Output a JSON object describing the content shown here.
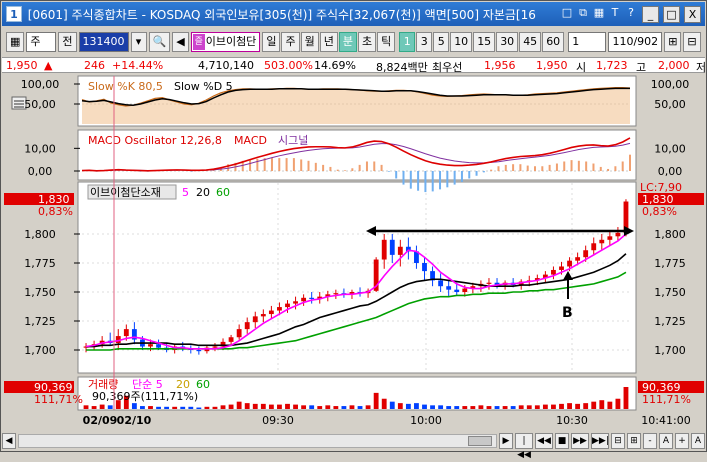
{
  "window": {
    "number_badge": "1",
    "title": "[0601] 주식종합차트 - KOSDAQ 외국인보유[305(천)] 주식수[32,067(천)] 액면[500] 자본금[16",
    "title_icons": [
      "□",
      "⧉",
      "▦",
      "T",
      "?"
    ],
    "controls": [
      "_",
      "□",
      "X"
    ]
  },
  "toolbar": {
    "list_icon": "▦",
    "market_select": "주",
    "all_label": "전",
    "stock_code": "131400",
    "search_icon": "🔍",
    "sound_icon": "◀",
    "event_stock": "이브이첨단",
    "period_buttons": [
      "일",
      "주",
      "월",
      "년",
      "분",
      "초",
      "틱"
    ],
    "active_period": "분",
    "interval_buttons": [
      "1",
      "3",
      "5",
      "10",
      "15",
      "30",
      "45",
      "60"
    ],
    "active_interval": "1",
    "interval_select": "1",
    "count_value": "110/902",
    "extra_icons": [
      "⊞",
      "⊟"
    ]
  },
  "pricebar": {
    "price": "1,950",
    "up_arrow": "▲",
    "change": "246",
    "rate": "+14.44%",
    "volume": "4,710,140",
    "vol_ratio": "503.00%",
    "turnover": "14.69%",
    "amount": "8,824백만",
    "prev_label": "최우선",
    "bid1": "1,956",
    "bid2": "1,950",
    "open_label": "시",
    "open": "1,723",
    "high_label": "고",
    "high": "2,000",
    "low_label": "저"
  },
  "stoch": {
    "legend_k": "Slow %K 80,5",
    "legend_d": "Slow %D 5",
    "y_ticks": [
      "100,00",
      "50,00"
    ],
    "k_series": [
      61,
      55,
      58,
      62,
      52,
      48,
      45,
      47,
      52,
      58,
      64,
      66,
      60,
      55,
      50,
      48,
      52,
      60,
      70,
      78,
      83,
      86,
      88,
      88,
      87,
      87,
      88,
      88,
      89,
      89,
      88,
      87,
      87,
      88,
      88,
      88,
      87,
      86,
      85,
      83,
      82,
      82,
      83,
      84,
      84,
      83,
      80,
      76,
      72,
      70,
      69,
      70,
      71,
      73,
      74,
      75,
      74,
      73,
      73,
      72,
      72,
      73,
      75,
      76,
      77,
      78,
      80,
      82,
      84,
      86,
      88,
      89,
      90,
      91,
      91,
      90
    ],
    "d_series": [
      58,
      56,
      57,
      59,
      55,
      51,
      48,
      47,
      50,
      55,
      60,
      63,
      61,
      57,
      53,
      50,
      51,
      56,
      65,
      73,
      80,
      84,
      86,
      87,
      87,
      87,
      87,
      88,
      88,
      88,
      88,
      87,
      87,
      87,
      87,
      87,
      87,
      86,
      85,
      84,
      83,
      82,
      82,
      83,
      83,
      83,
      81,
      78,
      75,
      72,
      70,
      70,
      70,
      71,
      72,
      73,
      73,
      73,
      73,
      72,
      72,
      72,
      73,
      74,
      75,
      76,
      78,
      80,
      82,
      84,
      86,
      87,
      88,
      89,
      89,
      89
    ]
  },
  "macd": {
    "legend": "MACD Oscillator 12,26,8",
    "legend_macd": "MACD",
    "legend_signal": "시그널",
    "y_ticks": [
      "10,00",
      "0,00"
    ],
    "macd_series": [
      0.2,
      0.3,
      0.1,
      0.2,
      0.4,
      0.6,
      0.4,
      0.3,
      0.2,
      0.1,
      0.2,
      0.3,
      0.4,
      0.5,
      0.4,
      0.3,
      0.3,
      0.4,
      0.8,
      1.4,
      2.2,
      3.0,
      4.0,
      5.0,
      6.0,
      6.9,
      7.8,
      8.6,
      9.3,
      9.9,
      10.3,
      10.6,
      10.7,
      10.7,
      10.6,
      10.3,
      10.2,
      10.6,
      11.5,
      12.6,
      13.2,
      13.0,
      12.0,
      10.5,
      8.8,
      7.2,
      5.8,
      4.5,
      3.6,
      3.0,
      2.6,
      2.4,
      2.4,
      2.6,
      2.9,
      3.4,
      4.0,
      4.8,
      5.5,
      6.0,
      6.4,
      6.6,
      6.8,
      7.2,
      7.8,
      8.6,
      9.5,
      10.4,
      11.0,
      11.4,
      11.5,
      11.2,
      11.0,
      11.6,
      12.8,
      14.6
    ],
    "signal_series": [
      0.2,
      0.2,
      0.2,
      0.2,
      0.3,
      0.4,
      0.4,
      0.3,
      0.3,
      0.2,
      0.2,
      0.2,
      0.3,
      0.4,
      0.4,
      0.4,
      0.3,
      0.4,
      0.5,
      0.8,
      1.2,
      1.8,
      2.5,
      3.3,
      4.2,
      5.0,
      5.9,
      6.7,
      7.4,
      8.0,
      8.6,
      9.1,
      9.5,
      9.8,
      10.0,
      10.1,
      10.1,
      10.2,
      10.6,
      11.2,
      11.8,
      12.1,
      12.1,
      11.6,
      10.8,
      9.8,
      8.7,
      7.6,
      6.6,
      5.7,
      5.0,
      4.4,
      4.0,
      3.7,
      3.6,
      3.6,
      3.8,
      4.1,
      4.6,
      5.0,
      5.4,
      5.8,
      6.1,
      6.5,
      6.9,
      7.5,
      8.1,
      8.8,
      9.5,
      10.0,
      10.4,
      10.6,
      10.7,
      10.9,
      11.4,
      12.2
    ]
  },
  "price": {
    "legend_name": "이브이첨단소재",
    "legend_ma": [
      "5",
      "20",
      "60"
    ],
    "y_ticks": [
      "1,800",
      "1,775",
      "1,750",
      "1,725",
      "1,700"
    ],
    "left_price": "1,830",
    "left_rate": "0,83%",
    "right_top_label": "LC:7,90",
    "right_price": "1,830",
    "right_rate": "0,83%",
    "annotation": "B",
    "ohlc": [
      [
        1702,
        1706,
        1698,
        1703
      ],
      [
        1703,
        1708,
        1700,
        1705
      ],
      [
        1705,
        1712,
        1702,
        1708
      ],
      [
        1708,
        1715,
        1704,
        1706
      ],
      [
        1706,
        1718,
        1700,
        1712
      ],
      [
        1712,
        1722,
        1708,
        1718
      ],
      [
        1718,
        1724,
        1705,
        1709
      ],
      [
        1709,
        1712,
        1700,
        1703
      ],
      [
        1703,
        1709,
        1699,
        1705
      ],
      [
        1705,
        1709,
        1700,
        1702
      ],
      [
        1702,
        1706,
        1698,
        1700
      ],
      [
        1700,
        1705,
        1697,
        1703
      ],
      [
        1703,
        1707,
        1699,
        1701
      ],
      [
        1701,
        1704,
        1697,
        1700
      ],
      [
        1700,
        1703,
        1696,
        1699
      ],
      [
        1699,
        1704,
        1697,
        1702
      ],
      [
        1702,
        1706,
        1699,
        1703
      ],
      [
        1703,
        1710,
        1700,
        1707
      ],
      [
        1707,
        1713,
        1704,
        1711
      ],
      [
        1711,
        1722,
        1709,
        1718
      ],
      [
        1718,
        1728,
        1714,
        1724
      ],
      [
        1724,
        1733,
        1719,
        1729
      ],
      [
        1729,
        1735,
        1724,
        1731
      ],
      [
        1731,
        1738,
        1727,
        1734
      ],
      [
        1734,
        1741,
        1730,
        1737
      ],
      [
        1737,
        1743,
        1732,
        1740
      ],
      [
        1740,
        1746,
        1735,
        1742
      ],
      [
        1742,
        1748,
        1738,
        1745
      ],
      [
        1745,
        1750,
        1740,
        1744
      ],
      [
        1744,
        1750,
        1740,
        1746
      ],
      [
        1746,
        1751,
        1742,
        1748
      ],
      [
        1748,
        1752,
        1744,
        1749
      ],
      [
        1749,
        1753,
        1745,
        1748
      ],
      [
        1748,
        1752,
        1744,
        1750
      ],
      [
        1750,
        1754,
        1746,
        1749
      ],
      [
        1749,
        1753,
        1745,
        1751
      ],
      [
        1751,
        1780,
        1750,
        1778
      ],
      [
        1778,
        1800,
        1770,
        1795
      ],
      [
        1795,
        1800,
        1775,
        1782
      ],
      [
        1782,
        1795,
        1772,
        1789
      ],
      [
        1789,
        1797,
        1778,
        1785
      ],
      [
        1785,
        1790,
        1770,
        1775
      ],
      [
        1775,
        1780,
        1760,
        1768
      ],
      [
        1768,
        1772,
        1755,
        1760
      ],
      [
        1760,
        1766,
        1750,
        1755
      ],
      [
        1755,
        1760,
        1746,
        1752
      ],
      [
        1752,
        1758,
        1747,
        1750
      ],
      [
        1750,
        1756,
        1746,
        1753
      ],
      [
        1753,
        1758,
        1749,
        1755
      ],
      [
        1755,
        1760,
        1750,
        1757
      ],
      [
        1757,
        1762,
        1752,
        1758
      ],
      [
        1758,
        1762,
        1753,
        1756
      ],
      [
        1756,
        1760,
        1752,
        1758
      ],
      [
        1758,
        1762,
        1754,
        1756
      ],
      [
        1756,
        1761,
        1752,
        1759
      ],
      [
        1759,
        1764,
        1755,
        1760
      ],
      [
        1760,
        1765,
        1756,
        1762
      ],
      [
        1762,
        1768,
        1758,
        1765
      ],
      [
        1765,
        1772,
        1761,
        1769
      ],
      [
        1769,
        1776,
        1765,
        1772
      ],
      [
        1772,
        1780,
        1768,
        1777
      ],
      [
        1777,
        1784,
        1773,
        1780
      ],
      [
        1780,
        1790,
        1776,
        1786
      ],
      [
        1786,
        1797,
        1782,
        1792
      ],
      [
        1792,
        1800,
        1786,
        1795
      ],
      [
        1795,
        1802,
        1790,
        1798
      ],
      [
        1798,
        1806,
        1794,
        1801
      ],
      [
        1801,
        1830,
        1798,
        1828
      ]
    ],
    "ma5": [
      1703,
      1704,
      1706,
      1707,
      1708,
      1710,
      1711,
      1710,
      1708,
      1706,
      1704,
      1702,
      1702,
      1701,
      1701,
      1701,
      1701,
      1702,
      1704,
      1708,
      1713,
      1718,
      1723,
      1727,
      1731,
      1735,
      1738,
      1741,
      1743,
      1744,
      1746,
      1747,
      1748,
      1748,
      1749,
      1750,
      1755,
      1764,
      1772,
      1779,
      1786,
      1785,
      1780,
      1774,
      1767,
      1762,
      1757,
      1754,
      1753,
      1753,
      1755,
      1756,
      1757,
      1757,
      1758,
      1759,
      1760,
      1762,
      1764,
      1767,
      1770,
      1774,
      1778,
      1782,
      1786,
      1790,
      1794,
      1800
    ],
    "ma20": [
      1703,
      1703,
      1704,
      1704,
      1705,
      1705,
      1706,
      1706,
      1706,
      1706,
      1706,
      1705,
      1705,
      1705,
      1704,
      1704,
      1704,
      1704,
      1704,
      1705,
      1706,
      1708,
      1710,
      1712,
      1714,
      1717,
      1720,
      1722,
      1725,
      1728,
      1730,
      1732,
      1734,
      1736,
      1738,
      1739,
      1742,
      1746,
      1750,
      1754,
      1757,
      1759,
      1760,
      1761,
      1761,
      1760,
      1759,
      1758,
      1757,
      1756,
      1755,
      1755,
      1755,
      1755,
      1756,
      1756,
      1757,
      1758,
      1759,
      1760,
      1761,
      1763,
      1765,
      1767,
      1770,
      1773,
      1777,
      1783
    ],
    "ma60": [
      1700,
      1700,
      1700,
      1700,
      1701,
      1701,
      1701,
      1701,
      1701,
      1701,
      1701,
      1701,
      1701,
      1701,
      1701,
      1701,
      1701,
      1701,
      1701,
      1702,
      1702,
      1703,
      1704,
      1705,
      1706,
      1707,
      1708,
      1710,
      1712,
      1714,
      1716,
      1718,
      1720,
      1722,
      1724,
      1726,
      1728,
      1731,
      1734,
      1737,
      1740,
      1742,
      1744,
      1745,
      1746,
      1746,
      1747,
      1747,
      1748,
      1748,
      1749,
      1749,
      1749,
      1750,
      1750,
      1751,
      1751,
      1752,
      1752,
      1753,
      1754,
      1755,
      1756,
      1757,
      1759,
      1761,
      1763,
      1767
    ]
  },
  "volume": {
    "legend_label": "거래량",
    "legend_ma_label": "단순 5",
    "legend_ma": [
      "20",
      "60"
    ],
    "legend_value": "90,369주(111,71%)",
    "left_value": "90,369",
    "left_rate": "111,71%",
    "right_value": "90,369",
    "right_rate": "111,71%",
    "values": [
      5,
      4,
      6,
      5,
      12,
      18,
      8,
      4,
      4,
      3,
      3,
      3,
      3,
      3,
      2,
      3,
      3,
      5,
      6,
      10,
      8,
      7,
      7,
      6,
      6,
      7,
      6,
      5,
      5,
      4,
      5,
      4,
      4,
      5,
      4,
      5,
      22,
      14,
      10,
      8,
      7,
      8,
      6,
      5,
      5,
      4,
      4,
      4,
      4,
      5,
      4,
      4,
      4,
      4,
      5,
      5,
      5,
      6,
      6,
      7,
      8,
      7,
      8,
      10,
      12,
      10,
      14,
      30
    ]
  },
  "x_axis": {
    "labels": [
      "02/09",
      "02/10",
      "09:30",
      "10:00",
      "10:30",
      "10:41:00"
    ]
  },
  "bottombar": {
    "buttons": [
      "◀",
      "▶",
      "|◀◀",
      "◀◀",
      "■",
      "▶▶",
      "▶▶|",
      "⊟",
      "⊞",
      "-",
      "A",
      "+",
      "A"
    ]
  },
  "colors": {
    "up": "#e00000",
    "down": "#0040ff",
    "ma5": "#ff00ff",
    "ma20": "#000000",
    "ma60": "#00a000",
    "stoch_k": "#c96a1a",
    "stoch_d": "#000000",
    "macd": "#dd0000",
    "signal": "#8030a0",
    "panel_bg": "#ffffff",
    "tag_red": "#e00000"
  }
}
